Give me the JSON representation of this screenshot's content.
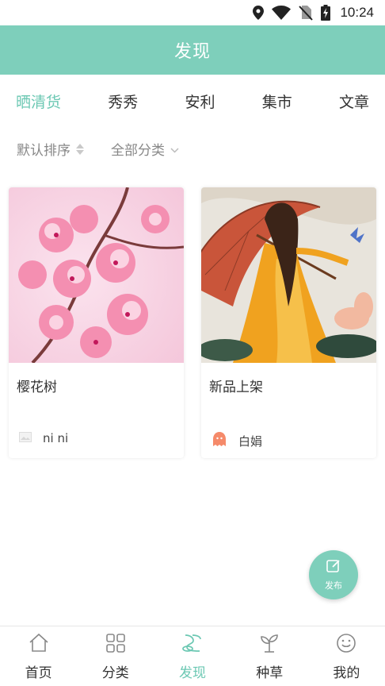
{
  "status_bar": {
    "time": "10:24",
    "icons": [
      "location-icon",
      "wifi-icon",
      "no-sim-icon",
      "battery-charging-icon"
    ]
  },
  "header": {
    "title": "发现"
  },
  "tabs": [
    {
      "label": "晒清货",
      "active": true
    },
    {
      "label": "秀秀",
      "active": false
    },
    {
      "label": "安利",
      "active": false
    },
    {
      "label": "集市",
      "active": false
    },
    {
      "label": "文章",
      "active": false
    }
  ],
  "filters": {
    "sort_label": "默认排序",
    "category_label": "全部分类"
  },
  "cards": [
    {
      "title": "樱花树",
      "user": "ni ni",
      "image": "cherry-blossom-photo",
      "avatar": "image-placeholder-icon"
    },
    {
      "title": "新品上架",
      "user": "白娟",
      "image": "painted-lady-with-umbrella",
      "avatar": "orange-ghost-avatar"
    }
  ],
  "fab": {
    "label": "发布"
  },
  "bottom_nav": [
    {
      "label": "首页",
      "icon": "home-icon",
      "active": false
    },
    {
      "label": "分类",
      "icon": "grid-icon",
      "active": false
    },
    {
      "label": "发现",
      "icon": "discover-icon",
      "active": true
    },
    {
      "label": "种草",
      "icon": "sprout-icon",
      "active": false
    },
    {
      "label": "我的",
      "icon": "smiley-icon",
      "active": false
    }
  ],
  "colors": {
    "accent": "#7ecfbb",
    "accent_text": "#6cc8b3",
    "muted": "#888888"
  }
}
